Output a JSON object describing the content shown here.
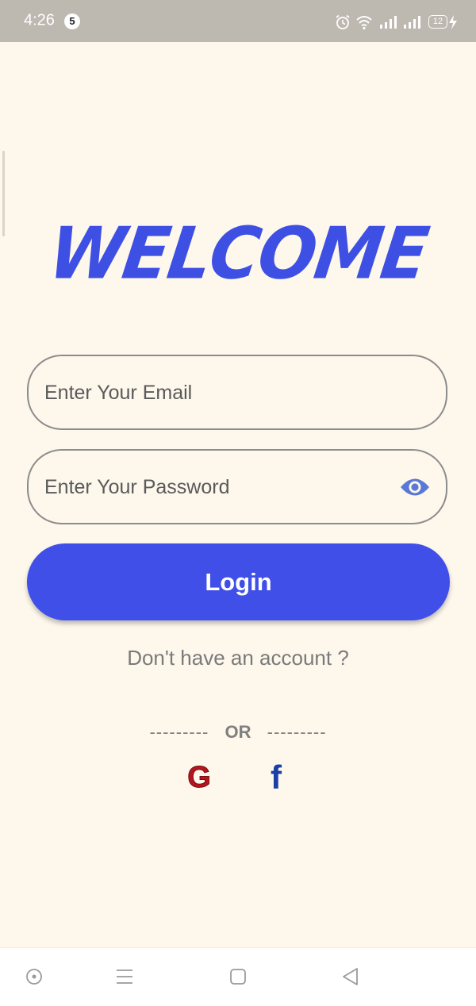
{
  "status_bar": {
    "time": "4:26",
    "notification_count": "5",
    "battery": "12"
  },
  "welcome_title": "WELCOME",
  "form": {
    "email_placeholder": "Enter Your Email",
    "email_value": "",
    "password_placeholder": "Enter Your Password",
    "password_value": ""
  },
  "login_label": "Login",
  "signup_text": "Don't have an account ?",
  "divider": {
    "left": "---------",
    "text": "OR",
    "right": "---------"
  },
  "social": {
    "google_letter": "G",
    "facebook_letter": "f"
  },
  "colors": {
    "accent": "#3f4fe8",
    "background": "#fdf7ec",
    "google_red": "#b3161f",
    "facebook_blue": "#1a3fa6"
  },
  "icons": {
    "password_toggle": "eye-icon",
    "status": [
      "alarm-icon",
      "wifi-icon",
      "signal-icon",
      "signal-icon",
      "battery-icon",
      "charging-icon"
    ],
    "navigation": [
      "assistant-icon",
      "menu-icon",
      "home-icon",
      "back-icon"
    ]
  }
}
